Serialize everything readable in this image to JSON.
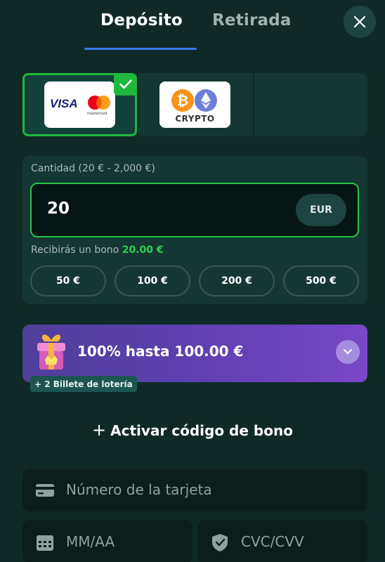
{
  "tabs": {
    "deposit": "Depósito",
    "withdraw": "Retirada"
  },
  "payment_methods": {
    "card_logo_text": "VISA",
    "mastercard_text": "mastercard",
    "crypto_label": "CRYPTO"
  },
  "amount": {
    "label": "Cantidad (20 € - 2,000 €)",
    "value": "20",
    "currency": "EUR",
    "bonus_prefix": "Recibirás un bono",
    "bonus_value": "20.00 €",
    "presets": [
      "50 €",
      "100 €",
      "200 €",
      "500 €"
    ]
  },
  "promo": {
    "title": "100% hasta 100.00 €",
    "lottery": "+ 2 Billete de lotería"
  },
  "bonus_code": {
    "plus": "+",
    "label": "Activar código de bono"
  },
  "card_form": {
    "card_number_placeholder": "Número de la tarjeta",
    "expiry_placeholder": "MM/AA",
    "cvc_placeholder": "CVC/CVV"
  },
  "colors": {
    "background": "#0f2a26",
    "accent_green": "#2fd153",
    "tab_underline": "#3a7bf2",
    "promo_gradient_start": "#4f3f9a",
    "promo_gradient_end": "#7a47c8"
  }
}
